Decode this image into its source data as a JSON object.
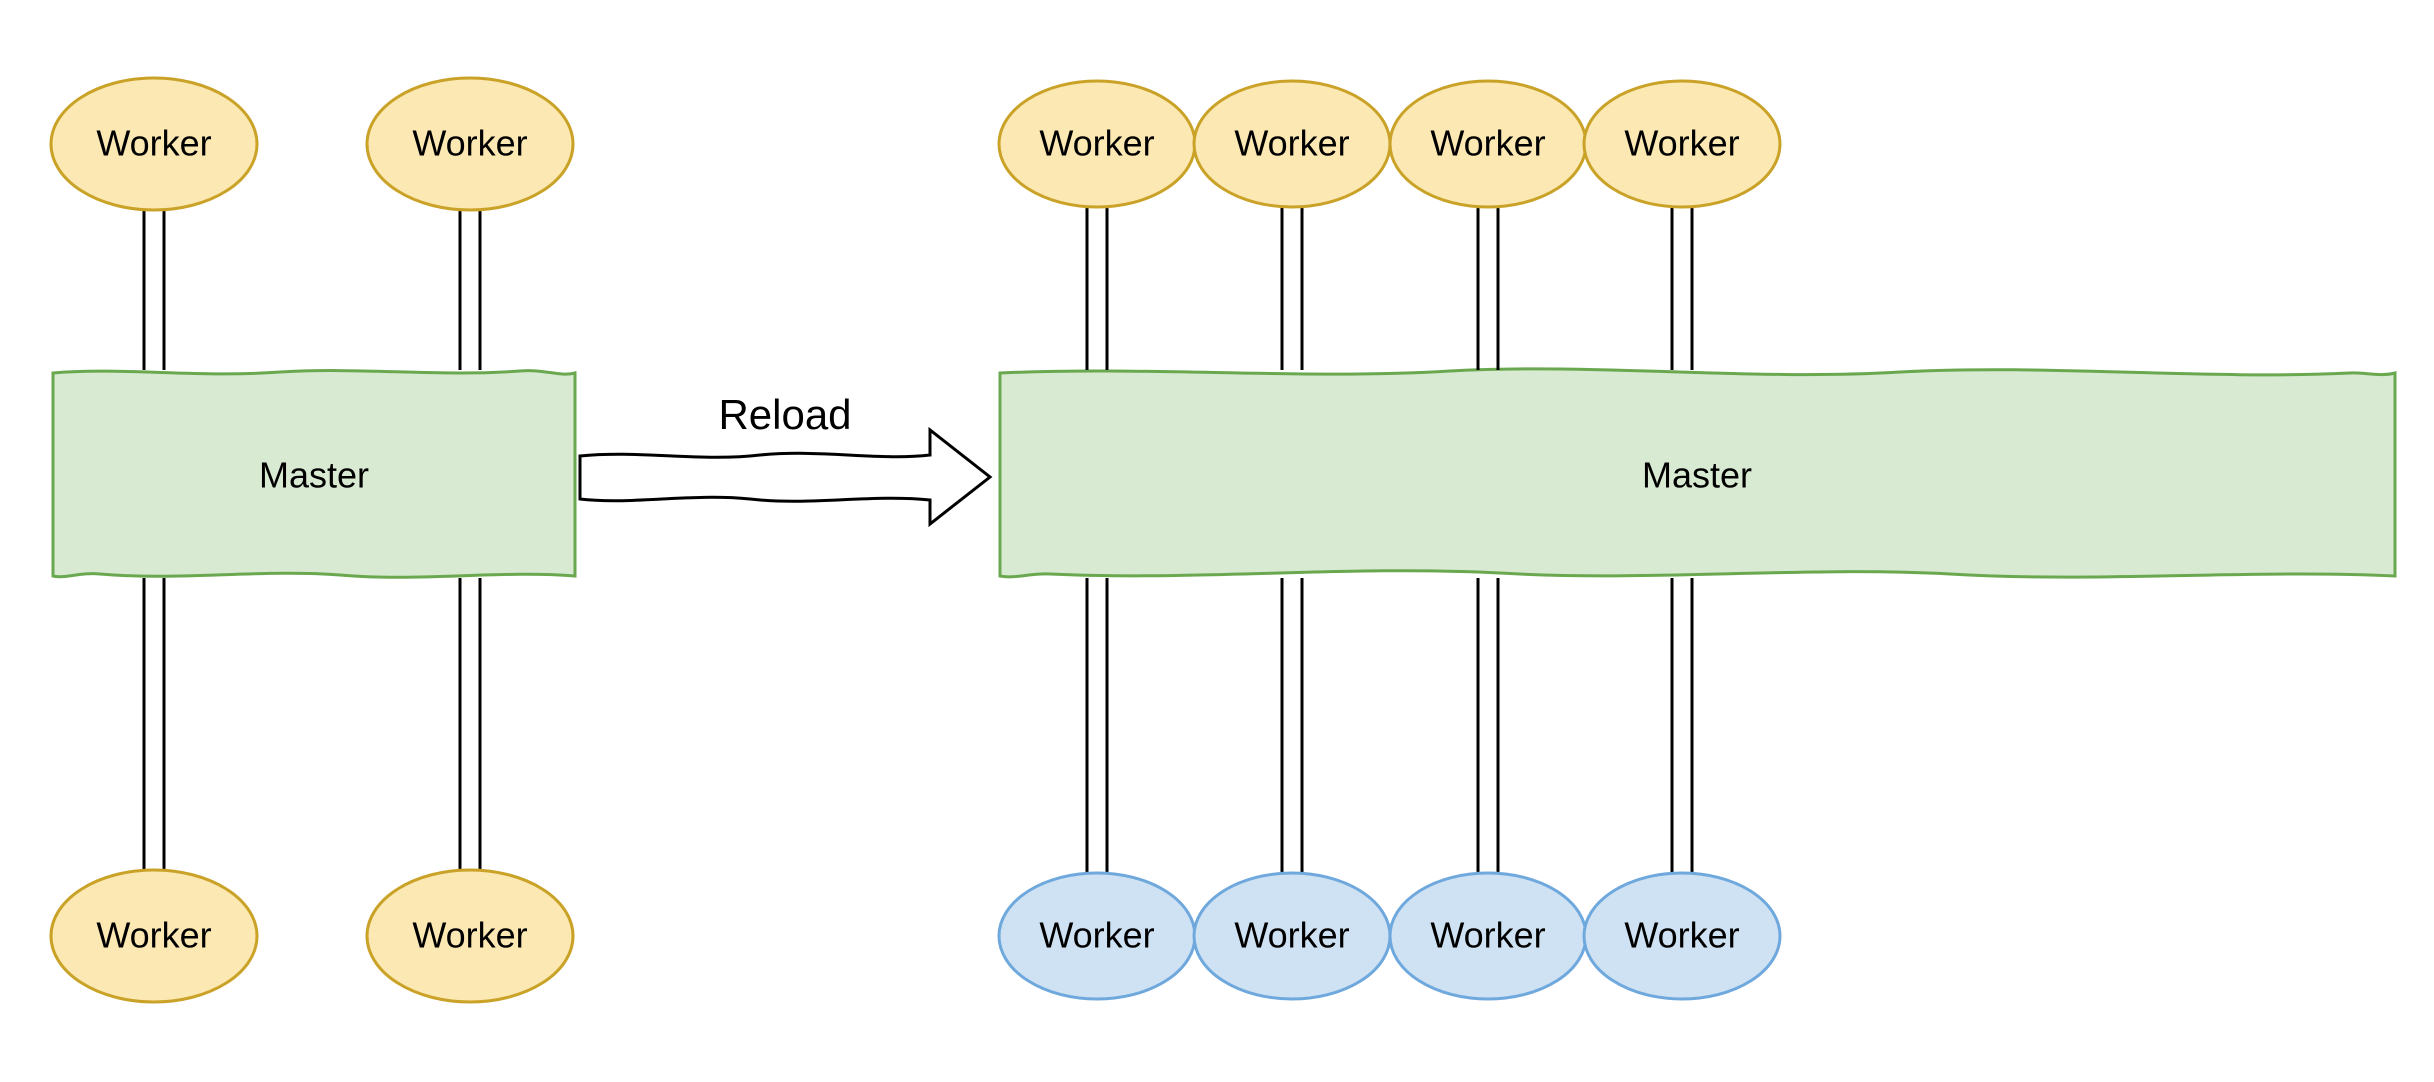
{
  "diagram": {
    "arrow_label": "Reload",
    "left": {
      "master_label": "Master",
      "workers_top": [
        "Worker",
        "Worker"
      ],
      "workers_bottom": [
        "Worker",
        "Worker"
      ]
    },
    "right": {
      "master_label": "Master",
      "workers_top": [
        "Worker",
        "Worker",
        "Worker",
        "Worker"
      ],
      "workers_bottom": [
        "Worker",
        "Worker",
        "Worker",
        "Worker"
      ]
    },
    "colors": {
      "worker_old_fill": "#fce8b2",
      "worker_old_stroke": "#c9a227",
      "worker_new_fill": "#cfe2f3",
      "worker_new_stroke": "#6fa8dc",
      "master_fill": "#d9ead3",
      "master_stroke": "#6aa84f",
      "stroke": "#000000"
    }
  }
}
